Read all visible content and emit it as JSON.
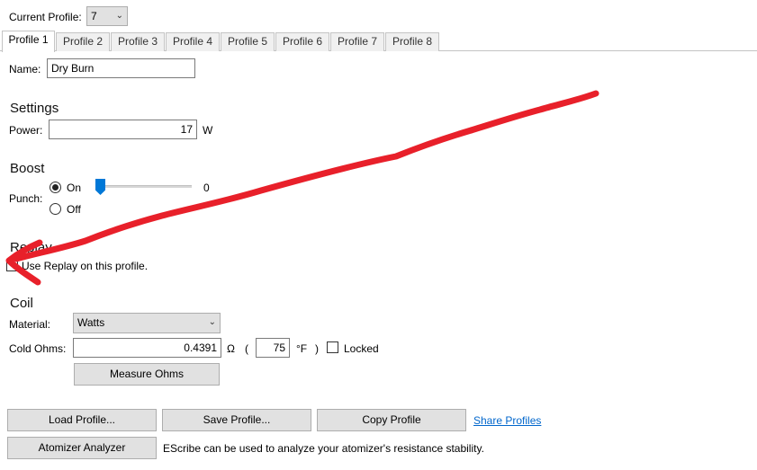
{
  "header": {
    "current_profile_label": "Current Profile:",
    "current_profile_value": "7"
  },
  "tabs": [
    {
      "label": "Profile 1",
      "active": true
    },
    {
      "label": "Profile 2",
      "active": false
    },
    {
      "label": "Profile 3",
      "active": false
    },
    {
      "label": "Profile 4",
      "active": false
    },
    {
      "label": "Profile 5",
      "active": false
    },
    {
      "label": "Profile 6",
      "active": false
    },
    {
      "label": "Profile 7",
      "active": false
    },
    {
      "label": "Profile 8",
      "active": false
    }
  ],
  "name": {
    "label": "Name:",
    "value": "Dry Burn"
  },
  "settings": {
    "title": "Settings",
    "power_label": "Power:",
    "power_value": "17",
    "power_unit": "W"
  },
  "boost": {
    "title": "Boost",
    "punch_label": "Punch:",
    "on_label": "On",
    "off_label": "Off",
    "selected": "On",
    "slider_value": "0"
  },
  "replay": {
    "title": "Replay",
    "checkbox_label": "Use Replay on this profile.",
    "checked": false
  },
  "coil": {
    "title": "Coil",
    "material_label": "Material:",
    "material_value": "Watts",
    "cold_ohms_label": "Cold Ohms:",
    "cold_ohms_value": "0.4391",
    "ohm_symbol": "Ω",
    "paren_open": "(",
    "temp_value": "75",
    "temp_unit": "°F",
    "paren_close": ")",
    "locked_label": "Locked",
    "locked_checked": false,
    "measure_button": "Measure Ohms"
  },
  "footer": {
    "load_button": "Load Profile...",
    "save_button": "Save Profile...",
    "copy_button": "Copy Profile",
    "share_link": "Share Profiles",
    "analyzer_button": "Atomizer Analyzer",
    "analyzer_note": "EScribe can be used to analyze your atomizer's resistance stability."
  },
  "annotation": {
    "color": "#e8202a"
  }
}
